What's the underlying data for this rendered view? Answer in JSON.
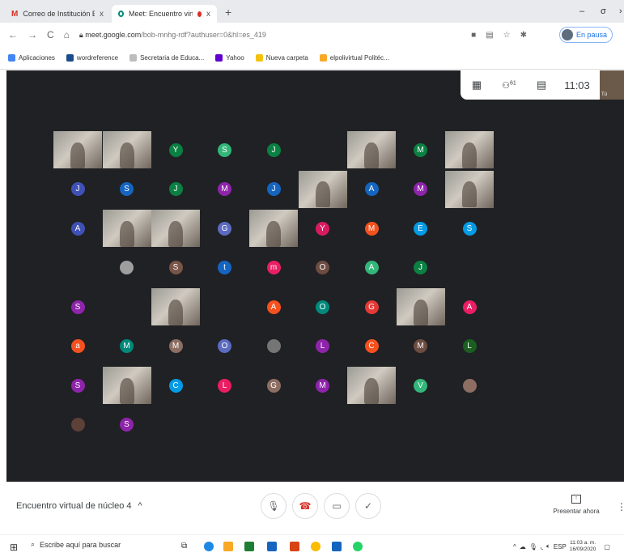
{
  "tabs": [
    {
      "title": "Correo de Institución Educativa |",
      "icon": "gmail-icon",
      "active": false
    },
    {
      "title": "Meet: Encuentro virtual de",
      "icon": "meet-icon",
      "active": true
    }
  ],
  "window_controls": {
    "minimize": "–",
    "restore": "σ",
    "close": "›"
  },
  "address": {
    "domain": "meet.google.com",
    "path": "/bob-mnhg-rdf?authuser=0&hl=es_419"
  },
  "profile_pill": "En pausa",
  "bookmarks": [
    "Aplicaciones",
    "wordreference",
    "Secretaria de Educa...",
    "Yahoo",
    "Nueva carpeta",
    "elpolivirtual Politéc..."
  ],
  "meet": {
    "participant_count": "61",
    "time": "11:03",
    "self_label": "Tú",
    "participants": [
      {
        "t": "v"
      },
      {
        "t": "v"
      },
      {
        "t": "a",
        "l": "Y",
        "c": "#0b8043"
      },
      {
        "t": "a",
        "l": "S",
        "c": "#33b679"
      },
      {
        "t": "a",
        "l": "J",
        "c": "#0b8043"
      },
      {
        "t": "e"
      },
      {
        "t": "v"
      },
      {
        "t": "a",
        "l": "M",
        "c": "#0b8043"
      },
      {
        "t": "v"
      },
      {
        "t": "a",
        "l": "J",
        "c": "#3f51b5"
      },
      {
        "t": "a",
        "l": "S",
        "c": "#1565c0"
      },
      {
        "t": "a",
        "l": "J",
        "c": "#0b8043"
      },
      {
        "t": "a",
        "l": "M",
        "c": "#8e24aa"
      },
      {
        "t": "a",
        "l": "J",
        "c": "#1565c0"
      },
      {
        "t": "v"
      },
      {
        "t": "a",
        "l": "A",
        "c": "#1565c0"
      },
      {
        "t": "a",
        "l": "M",
        "c": "#8e24aa"
      },
      {
        "t": "v"
      },
      {
        "t": "a",
        "l": "A",
        "c": "#3f51b5"
      },
      {
        "t": "v"
      },
      {
        "t": "v"
      },
      {
        "t": "a",
        "l": "G",
        "c": "#5c6bc0"
      },
      {
        "t": "v"
      },
      {
        "t": "a",
        "l": "Y",
        "c": "#d81b60"
      },
      {
        "t": "a",
        "l": "M",
        "c": "#f4511e"
      },
      {
        "t": "a",
        "l": "E",
        "c": "#039be5"
      },
      {
        "t": "a",
        "l": "S",
        "c": "#039be5"
      },
      {
        "t": "e"
      },
      {
        "t": "a",
        "l": "",
        "c": "#9e9e9e"
      },
      {
        "t": "a",
        "l": "S",
        "c": "#795548"
      },
      {
        "t": "a",
        "l": "t",
        "c": "#1565c0"
      },
      {
        "t": "a",
        "l": "m",
        "c": "#e91e63"
      },
      {
        "t": "a",
        "l": "O",
        "c": "#6d4c41"
      },
      {
        "t": "a",
        "l": "A",
        "c": "#33b679"
      },
      {
        "t": "a",
        "l": "J",
        "c": "#0b8043"
      },
      {
        "t": "e"
      },
      {
        "t": "a",
        "l": "S",
        "c": "#8e24aa"
      },
      {
        "t": "e"
      },
      {
        "t": "v"
      },
      {
        "t": "e"
      },
      {
        "t": "a",
        "l": "A",
        "c": "#f4511e"
      },
      {
        "t": "a",
        "l": "O",
        "c": "#00897b"
      },
      {
        "t": "a",
        "l": "G",
        "c": "#e53935"
      },
      {
        "t": "v"
      },
      {
        "t": "a",
        "l": "A",
        "c": "#e91e63"
      },
      {
        "t": "a",
        "l": "a",
        "c": "#f4511e"
      },
      {
        "t": "a",
        "l": "M",
        "c": "#00897b"
      },
      {
        "t": "a",
        "l": "M",
        "c": "#8d6e63"
      },
      {
        "t": "a",
        "l": "O",
        "c": "#5c6bc0"
      },
      {
        "t": "a",
        "l": "",
        "c": "#757575"
      },
      {
        "t": "a",
        "l": "L",
        "c": "#8e24aa"
      },
      {
        "t": "a",
        "l": "C",
        "c": "#f4511e"
      },
      {
        "t": "a",
        "l": "M",
        "c": "#6d4c41"
      },
      {
        "t": "a",
        "l": "L",
        "c": "#1b5e20"
      },
      {
        "t": "a",
        "l": "S",
        "c": "#8e24aa"
      },
      {
        "t": "v"
      },
      {
        "t": "a",
        "l": "C",
        "c": "#039be5"
      },
      {
        "t": "a",
        "l": "L",
        "c": "#e91e63"
      },
      {
        "t": "a",
        "l": "G",
        "c": "#8d6e63"
      },
      {
        "t": "a",
        "l": "M",
        "c": "#8e24aa"
      },
      {
        "t": "v"
      },
      {
        "t": "a",
        "l": "V",
        "c": "#33b679"
      },
      {
        "t": "a",
        "l": "",
        "c": "#8d6e63"
      },
      {
        "t": "a",
        "l": "",
        "c": "#5d4037"
      },
      {
        "t": "a",
        "l": "S",
        "c": "#8e24aa"
      }
    ]
  },
  "meeting_title": "Encuentro virtual de núcleo 4",
  "meeting_title_chevron": "^",
  "present_label": "Presentar ahora",
  "taskbar": {
    "search_placeholder": "Escribe aquí para buscar",
    "lang": "ESP",
    "time": "11:03 a. m.",
    "date": "16/09/2020"
  }
}
